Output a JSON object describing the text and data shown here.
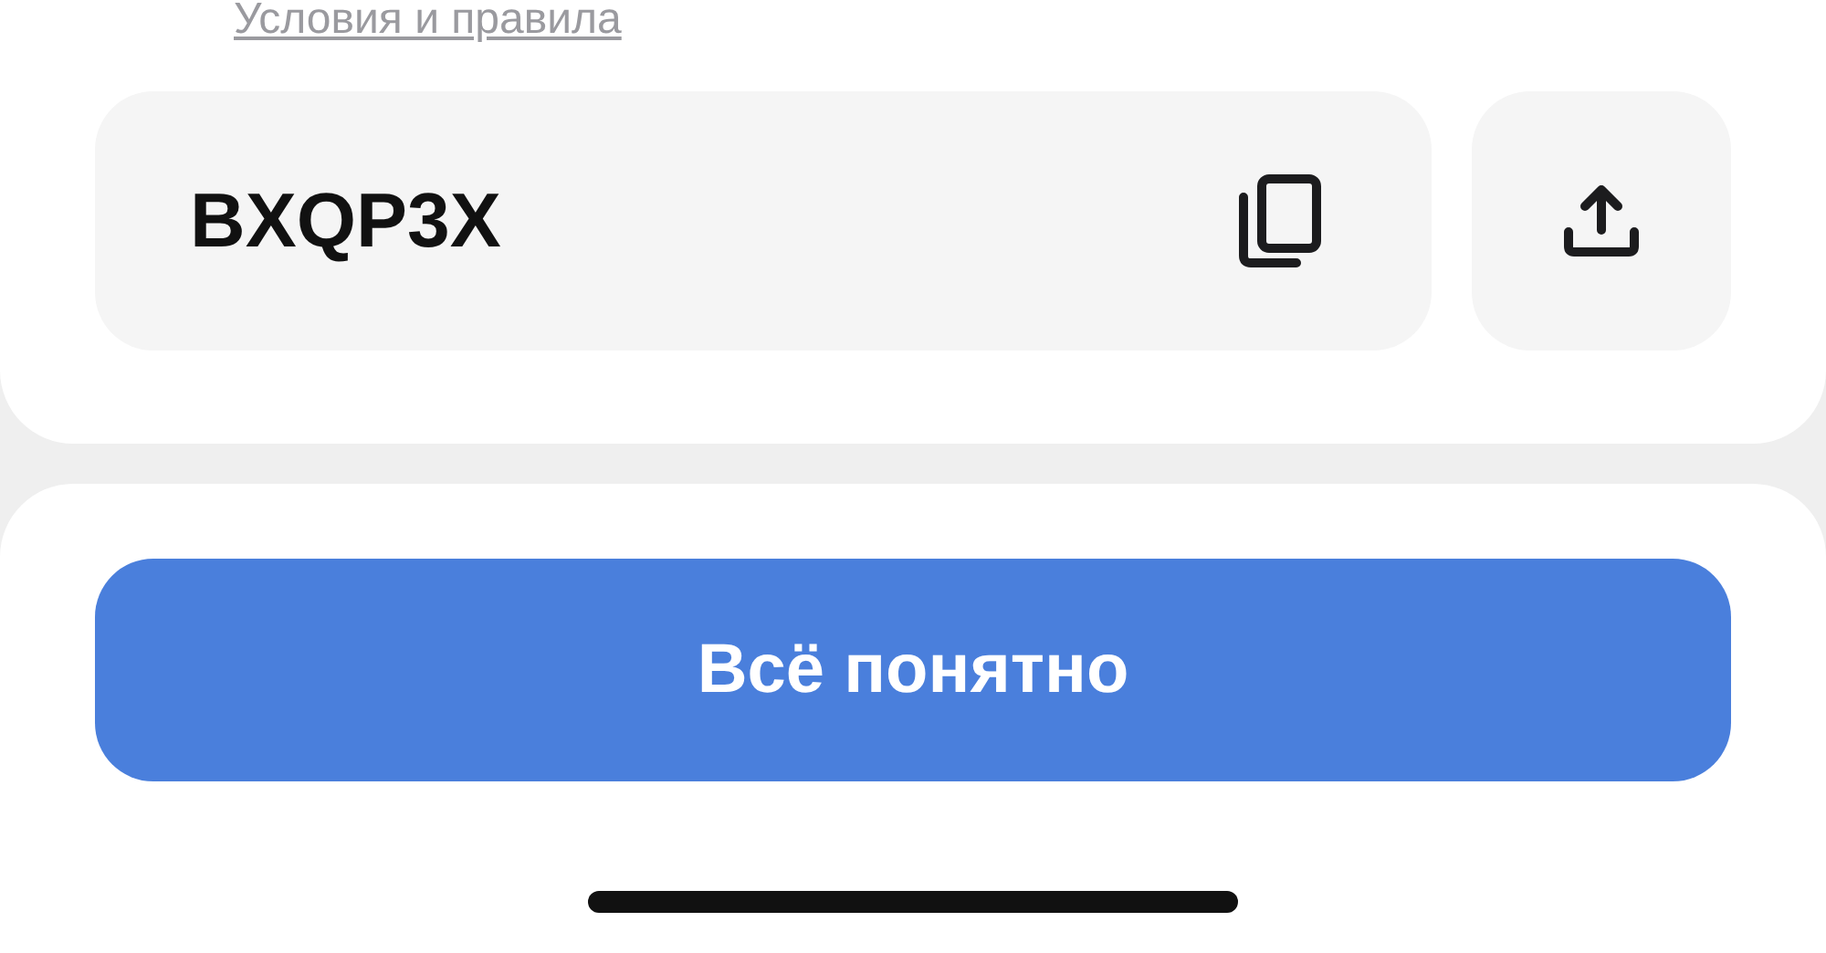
{
  "terms_link": "Условия и правила",
  "promo_code": {
    "value": "BXQP3X"
  },
  "confirm_button": "Всё понятно"
}
